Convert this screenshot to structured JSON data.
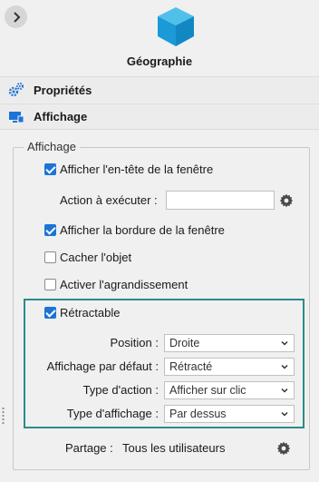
{
  "header": {
    "title": "Géographie",
    "icon": "cube-icon",
    "accent_color": "#1fa3d8"
  },
  "nav": {
    "properties_label": "Propriétés",
    "display_label": "Affichage"
  },
  "group": {
    "title": "Affichage",
    "show_header_label": "Afficher l'en-tête de la fenêtre",
    "show_header_checked": true,
    "action_label": "Action à exécuter :",
    "action_value": "",
    "show_border_label": "Afficher la bordure de la fenêtre",
    "show_border_checked": true,
    "hide_object_label": "Cacher l'objet",
    "hide_object_checked": false,
    "enlarge_label": "Activer l'agrandissement",
    "enlarge_checked": false,
    "retractable_label": "Rétractable",
    "retractable_checked": true,
    "retractable_border_color": "#2a8c8a"
  },
  "retractable": {
    "position_label": "Position :",
    "position_value": "Droite",
    "default_label": "Affichage par défaut :",
    "default_value": "Rétracté",
    "action_type_label": "Type d'action :",
    "action_type_value": "Afficher sur clic",
    "display_type_label": "Type d'affichage :",
    "display_type_value": "Par dessus"
  },
  "sharing": {
    "label": "Partage :",
    "value": "Tous les utilisateurs"
  }
}
